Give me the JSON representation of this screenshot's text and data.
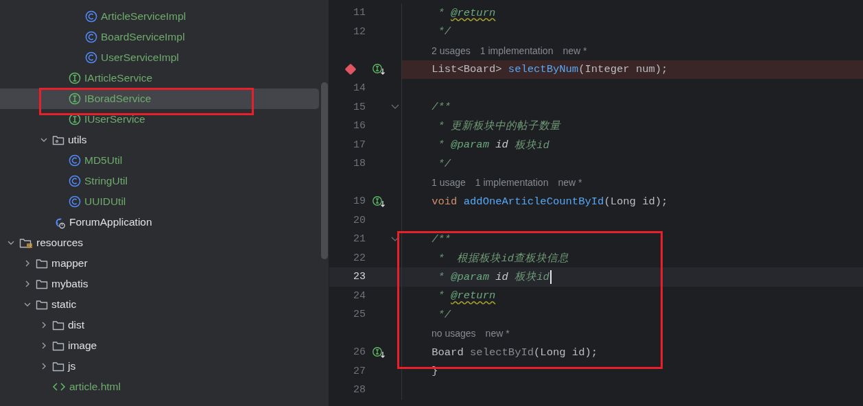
{
  "project_tree": {
    "items": [
      {
        "children": [
          {
            "children": [
              {
                "children": [
                  {
                    "children": [
                      {
                        "label": "ArticleServiceImpl",
                        "kind": "class",
                        "color": "#6fab6d",
                        "selected": false
                      },
                      {
                        "label": "BoardServiceImpl",
                        "kind": "class",
                        "color": "#6fab6d",
                        "selected": false
                      },
                      {
                        "label": "UserServiceImpl",
                        "kind": "class",
                        "color": "#6fab6d",
                        "selected": false
                      }
                    ]
                  },
                  {
                    "label": "IArticleService",
                    "kind": "interface",
                    "color": "#6fab6d",
                    "selected": false
                  },
                  {
                    "label": "IBoradService",
                    "kind": "interface",
                    "color": "#6fab6d",
                    "selected": true
                  },
                  {
                    "label": "IUserService",
                    "kind": "interface",
                    "color": "#6fab6d",
                    "selected": false
                  }
                ]
              },
              {
                "label": "utils",
                "kind": "package",
                "color": "#dfe1e5",
                "selected": false,
                "expanded": true,
                "children": [
                  {
                    "label": "MD5Util",
                    "kind": "class",
                    "color": "#6fab6d",
                    "selected": false
                  },
                  {
                    "label": "StringUtil",
                    "kind": "class",
                    "color": "#6fab6d",
                    "selected": false
                  },
                  {
                    "label": "UUIDUtil",
                    "kind": "class",
                    "color": "#6fab6d",
                    "selected": false
                  }
                ]
              },
              {
                "label": "ForumApplication",
                "kind": "app",
                "color": "#dfe1e5",
                "selected": false
              }
            ]
          }
        ]
      },
      {
        "label": "resources",
        "kind": "resources",
        "color": "#dfe1e5",
        "selected": false,
        "expanded": true,
        "children": [
          {
            "label": "mapper",
            "kind": "folder",
            "color": "#dfe1e5",
            "selected": false,
            "expanded": false
          },
          {
            "label": "mybatis",
            "kind": "folder",
            "color": "#dfe1e5",
            "selected": false,
            "expanded": false
          },
          {
            "label": "static",
            "kind": "folder",
            "color": "#dfe1e5",
            "selected": false,
            "expanded": true,
            "children": [
              {
                "label": "dist",
                "kind": "folder",
                "color": "#dfe1e5",
                "selected": false,
                "expanded": false
              },
              {
                "label": "image",
                "kind": "folder",
                "color": "#dfe1e5",
                "selected": false,
                "expanded": false
              },
              {
                "label": "js",
                "kind": "folder",
                "color": "#dfe1e5",
                "selected": false,
                "expanded": false
              },
              {
                "label": "article.html",
                "kind": "html",
                "color": "#6fab6d",
                "selected": false
              }
            ]
          }
        ]
      }
    ]
  },
  "editor": {
    "lines": [
      {
        "kind": "code",
        "number": "11",
        "current": false,
        "breakpoint": false,
        "foldable": false,
        "implemented": false,
        "tokens": [
          {
            "kind": "comment",
            "text": " * "
          },
          {
            "kind": "doc-tag-warning",
            "text": "@return"
          }
        ]
      },
      {
        "kind": "code",
        "number": "12",
        "current": false,
        "breakpoint": false,
        "foldable": false,
        "implemented": false,
        "tokens": [
          {
            "kind": "comment",
            "text": " */"
          }
        ]
      },
      {
        "kind": "hint",
        "items": [
          "2 usages",
          "1 implementation",
          "new *"
        ]
      },
      {
        "kind": "code",
        "current": false,
        "breakpoint": true,
        "foldable": false,
        "implemented": true,
        "tokens": [
          {
            "kind": "plain",
            "text": "List<Board> "
          },
          {
            "kind": "method",
            "text": "selectByNum"
          },
          {
            "kind": "plain",
            "text": "(Integer num);"
          }
        ]
      },
      {
        "kind": "code",
        "number": "14",
        "current": false,
        "breakpoint": false,
        "foldable": false,
        "implemented": false
      },
      {
        "kind": "code",
        "number": "15",
        "current": false,
        "breakpoint": false,
        "foldable": true,
        "implemented": false,
        "tokens": [
          {
            "kind": "comment",
            "text": "/**"
          }
        ]
      },
      {
        "kind": "code",
        "number": "16",
        "current": false,
        "breakpoint": false,
        "foldable": false,
        "implemented": false,
        "tokens": [
          {
            "kind": "comment",
            "text": " * 更新板块中的帖子数量"
          }
        ]
      },
      {
        "kind": "code",
        "number": "17",
        "current": false,
        "breakpoint": false,
        "foldable": false,
        "implemented": false,
        "tokens": [
          {
            "kind": "comment",
            "text": " * "
          },
          {
            "kind": "doc-tag",
            "text": "@param"
          },
          {
            "kind": "doc-param",
            "text": " id"
          },
          {
            "kind": "comment",
            "text": " 板块id"
          }
        ]
      },
      {
        "kind": "code",
        "number": "18",
        "current": false,
        "breakpoint": false,
        "foldable": false,
        "implemented": false,
        "tokens": [
          {
            "kind": "comment",
            "text": " */"
          }
        ]
      },
      {
        "kind": "hint",
        "items": [
          "1 usage",
          "1 implementation",
          "new *"
        ]
      },
      {
        "kind": "code",
        "number": "19",
        "current": false,
        "breakpoint": false,
        "foldable": false,
        "implemented": true,
        "tokens": [
          {
            "kind": "keyword",
            "text": "void "
          },
          {
            "kind": "method",
            "text": "addOneArticleCountById"
          },
          {
            "kind": "plain",
            "text": "(Long id);"
          }
        ]
      },
      {
        "kind": "code",
        "number": "20",
        "current": false,
        "breakpoint": false,
        "foldable": false,
        "implemented": false
      },
      {
        "kind": "code",
        "number": "21",
        "current": false,
        "breakpoint": false,
        "foldable": true,
        "implemented": false,
        "tokens": [
          {
            "kind": "comment",
            "text": "/**"
          }
        ]
      },
      {
        "kind": "code",
        "number": "22",
        "current": false,
        "breakpoint": false,
        "foldable": false,
        "implemented": false,
        "tokens": [
          {
            "kind": "comment",
            "text": " *  根据板块id查板块信息"
          }
        ]
      },
      {
        "kind": "code",
        "number": "23",
        "current": true,
        "breakpoint": false,
        "foldable": false,
        "implemented": false,
        "tokens": [
          {
            "kind": "comment",
            "text": " * "
          },
          {
            "kind": "doc-tag",
            "text": "@param"
          },
          {
            "kind": "doc-param",
            "text": " id"
          },
          {
            "kind": "comment",
            "text": " 板块id"
          }
        ]
      },
      {
        "kind": "code",
        "number": "24",
        "current": false,
        "breakpoint": false,
        "foldable": false,
        "implemented": false,
        "tokens": [
          {
            "kind": "comment",
            "text": " * "
          },
          {
            "kind": "doc-tag-warning",
            "text": "@return"
          }
        ]
      },
      {
        "kind": "code",
        "number": "25",
        "current": false,
        "breakpoint": false,
        "foldable": false,
        "implemented": false,
        "tokens": [
          {
            "kind": "comment",
            "text": " */"
          }
        ]
      },
      {
        "kind": "hint",
        "items": [
          "no usages",
          "new *"
        ]
      },
      {
        "kind": "code",
        "number": "26",
        "current": false,
        "breakpoint": false,
        "foldable": false,
        "implemented": true,
        "tokens": [
          {
            "kind": "plain",
            "text": "Board "
          },
          {
            "kind": "unused",
            "text": "selectById"
          },
          {
            "kind": "plain",
            "text": "(Long id);"
          }
        ]
      },
      {
        "kind": "code",
        "number": "27",
        "current": false,
        "breakpoint": false,
        "foldable": false,
        "implemented": false,
        "tokens": [
          {
            "kind": "plain",
            "text": "}"
          }
        ]
      },
      {
        "kind": "code",
        "number": "28",
        "current": false,
        "breakpoint": false,
        "foldable": false,
        "implemented": false
      }
    ]
  },
  "annotation_boxes": {
    "project_tree": true,
    "editor": true
  }
}
